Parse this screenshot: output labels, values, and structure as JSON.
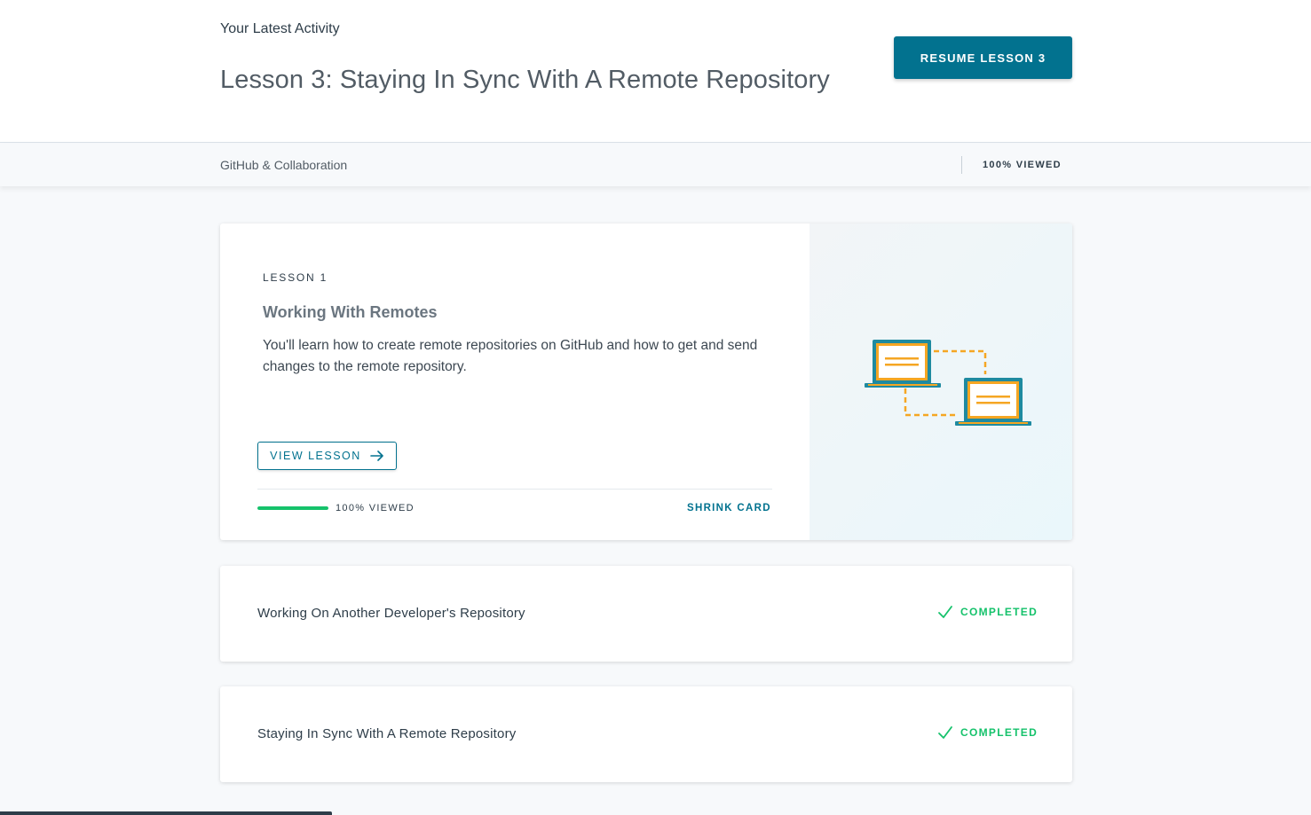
{
  "header": {
    "latest_label": "Your Latest Activity",
    "lesson_title": "Lesson 3: Staying In Sync With A Remote Repository",
    "resume_button": "RESUME LESSON 3"
  },
  "subbar": {
    "course_name": "GitHub & Collaboration",
    "viewed": "100% VIEWED"
  },
  "expanded_card": {
    "lesson_number": "LESSON 1",
    "title": "Working With Remotes",
    "description": "You'll learn how to create remote repositories on GitHub and how to get and send changes to the remote repository.",
    "view_button": "VIEW LESSON",
    "progress_fraction": 1.0,
    "progress_text": "100% VIEWED",
    "shrink_label": "SHRINK CARD",
    "illustration_icon": "laptops-sync-illustration"
  },
  "lessons": [
    {
      "title": "Working On Another Developer's Repository",
      "status": "COMPLETED",
      "status_icon": "check-icon"
    },
    {
      "title": "Staying In Sync With A Remote Repository",
      "status": "COMPLETED",
      "status_icon": "check-icon"
    }
  ],
  "colors": {
    "accent": "#02728f",
    "success": "#15c26b",
    "illustration_teal": "#1e8aa0",
    "illustration_amber": "#f5a623"
  }
}
